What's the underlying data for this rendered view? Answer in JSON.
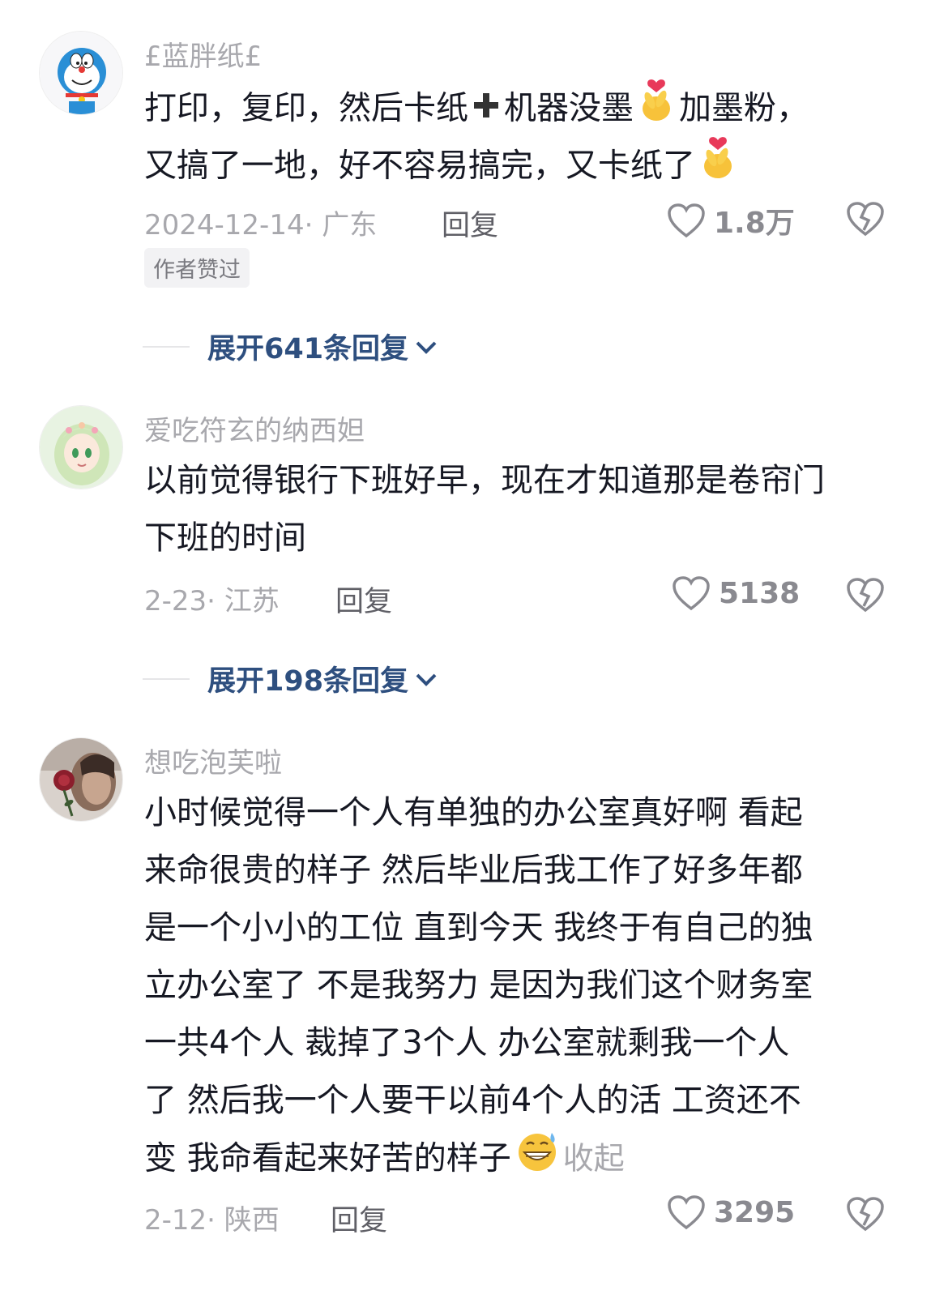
{
  "comments": [
    {
      "username": "£蓝胖纸£",
      "avatar_icon": "doraemon-avatar",
      "text_lines": [
        [
          "打印，复印，然后卡纸",
          "➕",
          "机器没墨",
          "🫰",
          "加墨粉，"
        ],
        [
          "又搞了一地，好不容易搞完，又卡纸了",
          "🫰"
        ]
      ],
      "date_location": "2024-12-14· 广东",
      "reply_label": "回复",
      "likes": "1.8万",
      "badge": "作者赞过",
      "expand_label": "展开641条回复"
    },
    {
      "username": "爱吃符玄的纳西妲",
      "avatar_icon": "anime-girl-avatar",
      "text_lines": [
        "以前觉得银行下班好早，现在才知道那是卷帘门",
        "下班的时间"
      ],
      "date_location": "2-23· 江苏",
      "reply_label": "回复",
      "likes": "5138",
      "expand_label": "展开198条回复"
    },
    {
      "username": "想吃泡芙啦",
      "avatar_icon": "rose-photo-avatar",
      "text_lines": [
        "小时候觉得一个人有单独的办公室真好啊  看起",
        "来命很贵的样子   然后毕业后我工作了好多年都",
        "是一个小小的工位   直到今天  我终于有自己的独",
        "立办公室了   不是我努力  是因为我们这个财务室",
        "一共4个人   裁掉了3个人  办公室就剩我一个人",
        "了  然后我一个人要干以前4个人的活  工资还不",
        "变  我命看起来好苦的样子"
      ],
      "text_end_emoji": "😅",
      "collapse_label": "收起",
      "date_location": "2-12· 陕西",
      "reply_label": "回复",
      "likes": "3295"
    }
  ],
  "icons": {
    "like": "heart-outline-icon",
    "dislike": "broken-heart-icon",
    "expand": "chevron-down-icon"
  },
  "colors": {
    "expand_link": "#2e4f7f",
    "secondary_text": "#a8a8ad"
  }
}
